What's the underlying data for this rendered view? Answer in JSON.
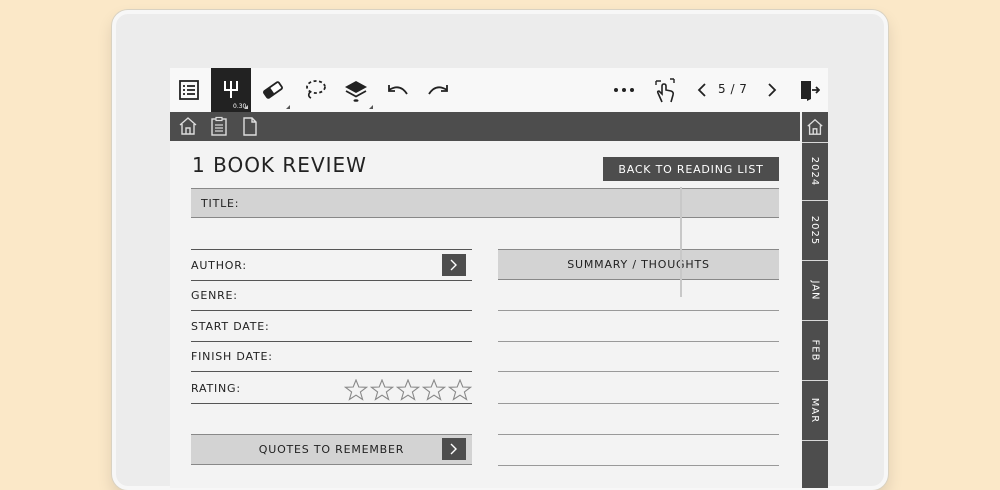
{
  "toolbar": {
    "pen_size": "0.30",
    "page_indicator": "5 / 7"
  },
  "side_tabs": [
    {
      "label": "2024"
    },
    {
      "label": "2025"
    },
    {
      "label": "JAN"
    },
    {
      "label": "FEB"
    },
    {
      "label": "MAR"
    }
  ],
  "page": {
    "title": "1 BOOK REVIEW",
    "back_button": "BACK TO READING LIST",
    "title_field": "TITLE:",
    "fields": {
      "author": "AUTHOR:",
      "genre": "GENRE:",
      "start_date": "START DATE:",
      "finish_date": "FINISH DATE:",
      "rating": "RATING:"
    },
    "rating_stars": 5,
    "summary_header": "SUMMARY / THOUGHTS",
    "quotes_header": "QUOTES TO REMEMBER"
  },
  "colors": {
    "background": "#fbe8c8",
    "dark_bar": "#4d4d4d",
    "header_gray": "#d3d3d3"
  }
}
